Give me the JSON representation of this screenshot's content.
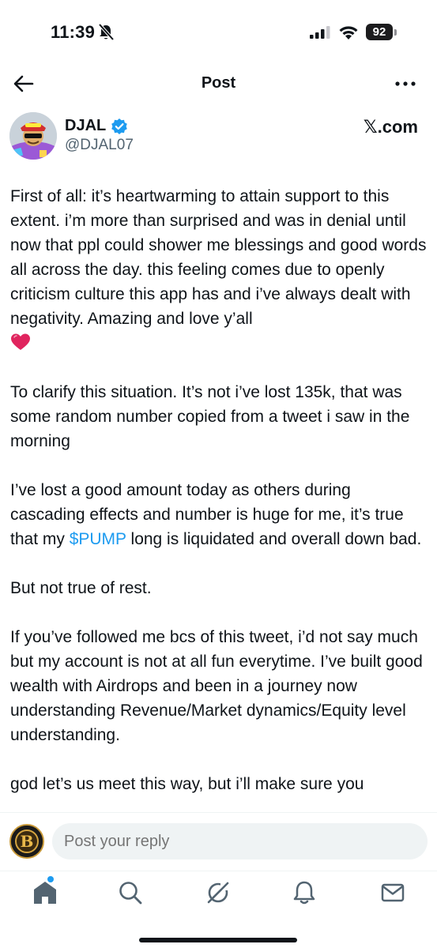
{
  "status_bar": {
    "time": "11:39",
    "battery": "92"
  },
  "nav": {
    "title": "Post"
  },
  "author": {
    "name": "DJAL",
    "handle": "@DJAL07",
    "source": "𝕏.com"
  },
  "post": {
    "paragraph_1": "First of all: it’s heartwarming to attain support to this extent. i’m more than surprised and was in denial until now that ppl could shower me blessings and good words all across the day. this feeling comes due to openly criticism culture this app has and i’ve always dealt with negativity. Amazing and love y’all",
    "paragraph_2": "To clarify this situation. It’s not i’ve lost 135k, that was some random number copied from a tweet i saw in the morning",
    "paragraph_3_before": "I’ve lost a good amount today as others during cascading effects and number is huge for me, it’s true that my ",
    "paragraph_3_cashtag": "$PUMP",
    "paragraph_3_after": " long is liquidated and overall down bad.",
    "paragraph_4": "But not true of rest.",
    "paragraph_5": "If you’ve followed me bcs of this tweet, i’d not say much but my account is not at all fun everytime. I’ve built good wealth with Airdrops and been in a journey now understanding Revenue/Market dynamics/Equity level understanding.",
    "paragraph_6": "god let’s us meet this way, but i’ll make sure you"
  },
  "reply": {
    "placeholder": "Post your reply"
  },
  "tabs": [
    {
      "icon": "home-icon"
    },
    {
      "icon": "search-icon"
    },
    {
      "icon": "grok-icon"
    },
    {
      "icon": "notifications-icon"
    },
    {
      "icon": "messages-icon"
    }
  ],
  "colors": {
    "accent": "#1d9bf0",
    "text": "#0f1419",
    "secondary": "#536471",
    "heart": "#e0245e"
  }
}
